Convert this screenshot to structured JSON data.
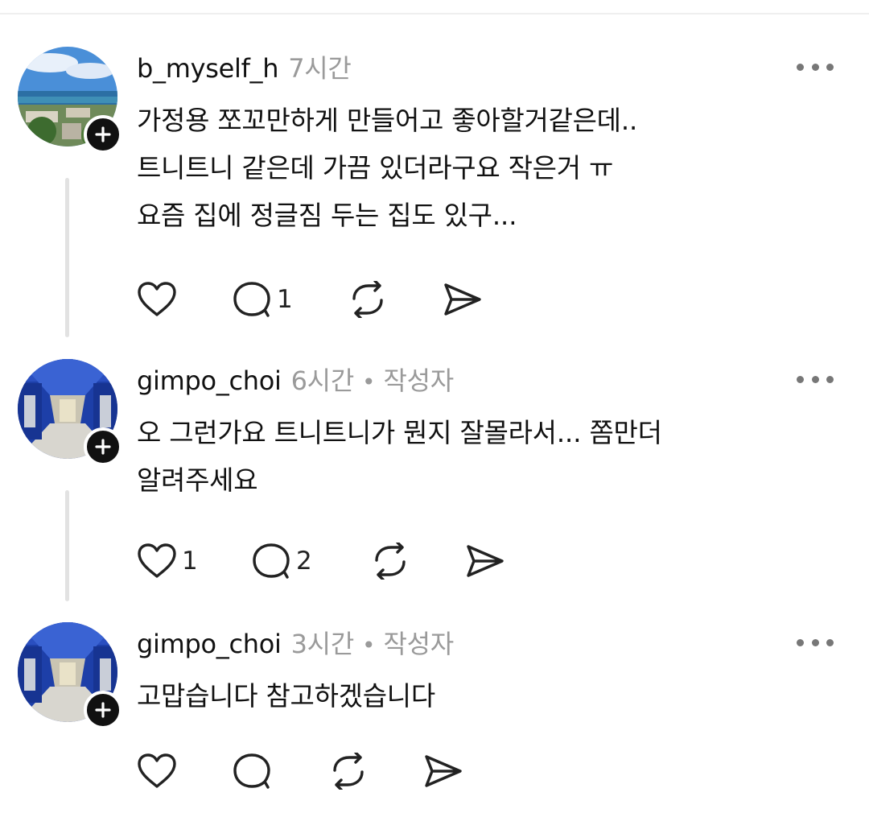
{
  "comments": [
    {
      "username": "b_myself_h",
      "time": "7시간",
      "author_tag": "",
      "lines": [
        "가정용 쪼꼬만하게 만들어고 좋아할거같은데..",
        "트니트니 같은데 가끔 있더라구요 작은거 ㅠ",
        "요즘 집에 정글짐 두는 집도 있구..."
      ],
      "likes": "",
      "replies": "1",
      "avatar": "ocean-landscape"
    },
    {
      "username": "gimpo_choi",
      "time": "6시간",
      "author_tag": "작성자",
      "lines": [
        "오 그런가요  트니트니가 뭔지 잘몰라서... 쫌만더",
        "알려주세요"
      ],
      "likes": "1",
      "replies": "2",
      "avatar": "blue-corridor"
    },
    {
      "username": "gimpo_choi",
      "time": "3시간",
      "author_tag": "작성자",
      "lines": [
        "고맙습니다 참고하겠습니다"
      ],
      "likes": "",
      "replies": "",
      "avatar": "blue-corridor"
    }
  ],
  "dot_separator": "•",
  "icons": {
    "like": "heart-icon",
    "reply": "comment-icon",
    "repost": "repost-icon",
    "share": "send-icon",
    "more": "more-icon",
    "follow": "plus-icon"
  }
}
